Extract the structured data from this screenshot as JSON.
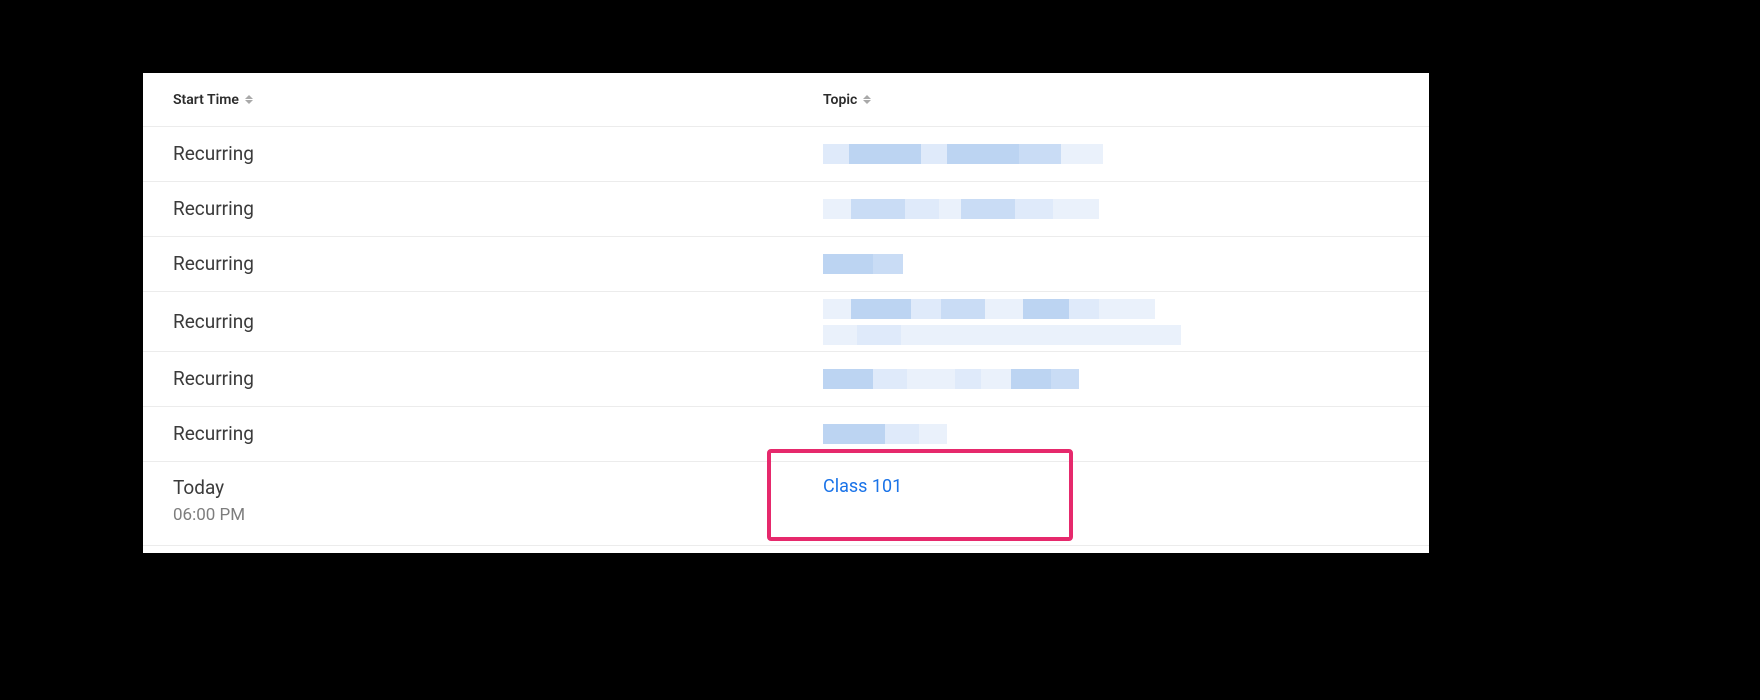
{
  "headers": {
    "start_time": "Start Time",
    "topic": "Topic"
  },
  "rows": [
    {
      "start_label": "Recurring",
      "start_sub": "",
      "topic_text": "",
      "topic_redacted": true
    },
    {
      "start_label": "Recurring",
      "start_sub": "",
      "topic_text": "",
      "topic_redacted": true
    },
    {
      "start_label": "Recurring",
      "start_sub": "",
      "topic_text": "",
      "topic_redacted": true
    },
    {
      "start_label": "Recurring",
      "start_sub": "",
      "topic_text": "",
      "topic_redacted": true
    },
    {
      "start_label": "Recurring",
      "start_sub": "",
      "topic_text": "",
      "topic_redacted": true
    },
    {
      "start_label": "Recurring",
      "start_sub": "",
      "topic_text": "",
      "topic_redacted": true
    },
    {
      "start_label": "Today",
      "start_sub": "06:00 PM",
      "topic_text": "Class 101",
      "topic_redacted": false
    }
  ],
  "icons": {
    "sort": "sort-icon"
  },
  "colors": {
    "link": "#1a73e8",
    "highlight": "#e6296c"
  }
}
